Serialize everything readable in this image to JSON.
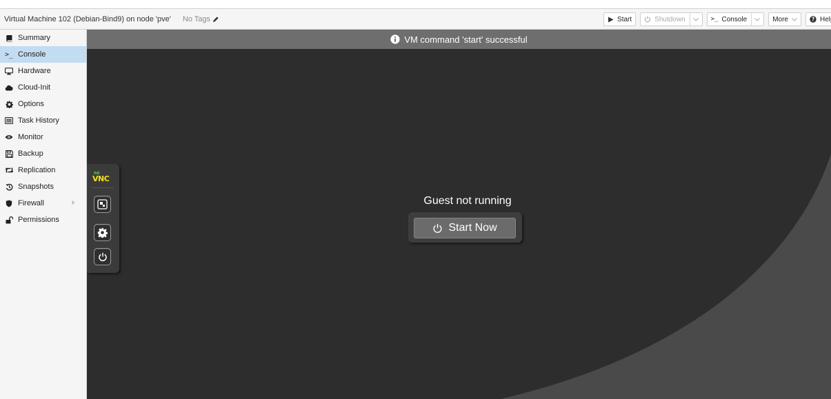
{
  "header": {
    "title": "Virtual Machine 102 (Debian-Bind9) on node 'pve'",
    "tags": "No Tags"
  },
  "toolbar": {
    "start": "Start",
    "shutdown": "Shutdown",
    "console": "Console",
    "more": "More",
    "help": "Help"
  },
  "sidebar": {
    "items": [
      {
        "label": "Summary",
        "icon": "book-icon"
      },
      {
        "label": "Console",
        "icon": "terminal-icon",
        "selected": true
      },
      {
        "label": "Hardware",
        "icon": "desktop-icon"
      },
      {
        "label": "Cloud-Init",
        "icon": "cloud-icon"
      },
      {
        "label": "Options",
        "icon": "gear-icon"
      },
      {
        "label": "Task History",
        "icon": "list-icon"
      },
      {
        "label": "Monitor",
        "icon": "eye-icon"
      },
      {
        "label": "Backup",
        "icon": "floppy-icon"
      },
      {
        "label": "Replication",
        "icon": "retweet-icon"
      },
      {
        "label": "Snapshots",
        "icon": "history-icon"
      },
      {
        "label": "Firewall",
        "icon": "shield-icon"
      },
      {
        "label": "Permissions",
        "icon": "unlock-icon"
      }
    ]
  },
  "main": {
    "banner": "VM command 'start' successful",
    "guest_status": "Guest not running",
    "start_now": "Start Now"
  },
  "colors": {
    "selected_nav": "#c2dcf1",
    "console_bg": "#2d2d2d",
    "banner_bg": "#6e6e6e",
    "novnc_logo_green": "#6ad04a",
    "novnc_logo_yellow": "#f2e21a"
  }
}
